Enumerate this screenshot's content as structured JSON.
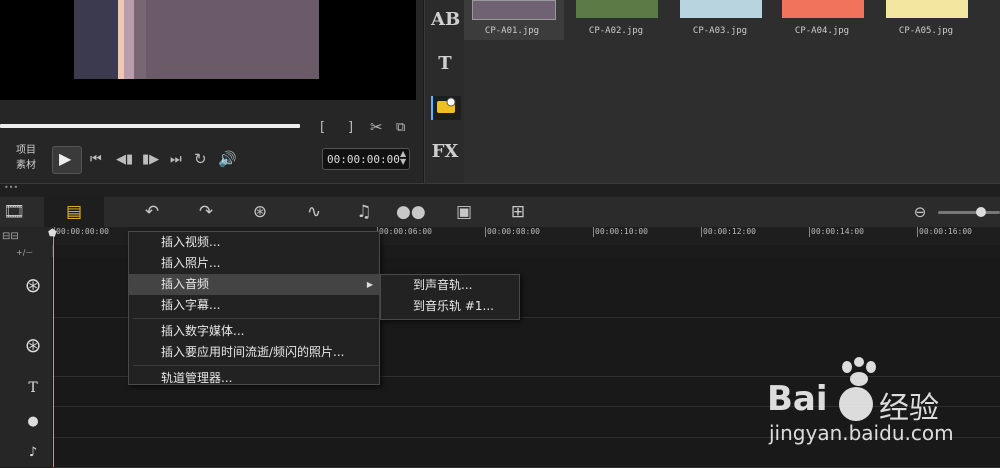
{
  "preview": {
    "mode_labels": [
      "项目",
      "素材"
    ],
    "timecode": "00:00:00:00",
    "stripe_colors": [
      "#3c3a4e",
      "#f0c7b2",
      "#b99cae",
      "#786672"
    ]
  },
  "side_tools": [
    {
      "name": "title-ab-icon",
      "label": "AB"
    },
    {
      "name": "text-icon",
      "label": "T"
    },
    {
      "name": "media-icon",
      "label": ""
    },
    {
      "name": "fx-icon",
      "label": "FX"
    }
  ],
  "library": {
    "thumbnails": [
      {
        "caption": "CP-A01.jpg",
        "color": "#6f6273"
      },
      {
        "caption": "CP-A02.jpg",
        "color": "#5c7a45"
      },
      {
        "caption": "CP-A03.jpg",
        "color": "#b8d4de"
      },
      {
        "caption": "CP-A04.jpg",
        "color": "#f2735c"
      },
      {
        "caption": "CP-A05.jpg",
        "color": "#f3e6a0"
      }
    ]
  },
  "timeline": {
    "ruler_ticks": [
      "00:00:00:00",
      "00:00:06:00",
      "00:00:08:00",
      "00:00:10:00",
      "00:00:12:00",
      "00:00:14:00",
      "00:00:16:00"
    ],
    "ruler_hidden": "+∕－"
  },
  "context_menu": {
    "items": [
      "插入视频...",
      "插入照片...",
      "插入音频",
      "插入字幕...",
      "插入数字媒体...",
      "插入要应用时间流逝/频闪的照片...",
      "轨道管理器..."
    ],
    "active_index": 2
  },
  "submenu": {
    "items": [
      "到声音轨...",
      "到音乐轨 #1..."
    ]
  },
  "watermark": {
    "brand": "Bai",
    "brand2": "经验",
    "url": "jingyan.baidu.com"
  }
}
